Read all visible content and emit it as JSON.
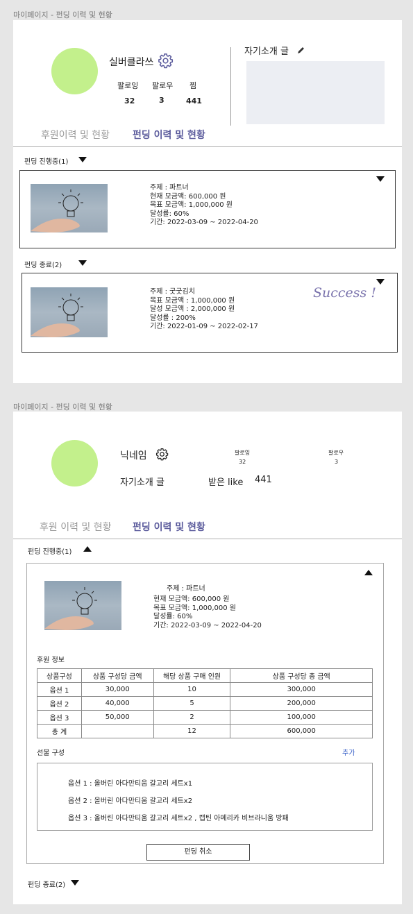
{
  "frame1": {
    "label": "마이페이지 - 펀딩 이력 및 현황",
    "profile": {
      "nickname": "실버클라쓰",
      "stats": [
        {
          "label": "팔로잉",
          "value": "32"
        },
        {
          "label": "팔로우",
          "value": "3"
        },
        {
          "label": "찜",
          "value": "441"
        }
      ]
    },
    "intro_title": "자기소개 글",
    "tabs": {
      "sponsor": "후원이력 및 현황",
      "funding": "펀딩 이력 및 현황"
    },
    "ongoing_header": "펀딩 진행중(1)",
    "ongoing_card": {
      "lines": [
        "주제 : 파트너",
        "현재 모금액: 600,000 원",
        "목표 모금액: 1,000,000 원",
        "달성률: 60%",
        "기간: 2022-03-09 ~ 2022-04-20"
      ]
    },
    "ended_header": "펀딩 종료(2)",
    "ended_card": {
      "lines": [
        "주제 : 굿굿김치",
        "목표 모금액 : 1,000,000 원",
        "달성 모금액 : 2,000,000 원",
        "달성률 : 200%",
        "기간: 2022-01-09 ~ 2022-02-17"
      ],
      "badge": "Success !"
    }
  },
  "frame2": {
    "label": "마이페이지 - 펀딩 이력 및 현황",
    "profile": {
      "nickname": "닉네임",
      "following_label": "팔로잉",
      "following_value": "32",
      "follower_label": "팔로우",
      "follower_value": "3",
      "intro": "자기소개 글",
      "likes_label": "받은 like",
      "likes_value": "441"
    },
    "tabs": {
      "sponsor": "후원 이력 및 현황",
      "funding": "펀딩 이력 및 현황"
    },
    "ongoing_header": "펀딩 진행중(1)",
    "card": {
      "lines": [
        "주제 : 파트너",
        "현재 모금액: 600,000 원",
        "목표 모금액: 1,000,000 원",
        "달성률: 60%",
        "기간: 2022-03-09 ~ 2022-04-20"
      ],
      "sponsor_title": "후원 정보",
      "table": {
        "headers": [
          "상품구성",
          "상품 구성당 금액",
          "해당 상품 구매 인원",
          "상품 구성당 총 금액"
        ],
        "rows": [
          [
            "옵션 1",
            "30,000",
            "10",
            "300,000"
          ],
          [
            "옵션 2",
            "40,000",
            "5",
            "200,000"
          ],
          [
            "옵션 3",
            "50,000",
            "2",
            "100,000"
          ],
          [
            "총 계",
            "",
            "12",
            "600,000"
          ]
        ]
      },
      "gift_title": "선물 구성",
      "add_label": "추가",
      "gifts": [
        "옵션 1 : 올버린 아다만티움 갈고리 세트x1",
        "옵션 2 : 올버린 아다만티움 갈고리 세트x2",
        "옵션 3 : 올버린 아다만티움 갈고리 세트x2 , 캡틴 아메리카 비브라니움 방패"
      ],
      "cancel_label": "펀딩 취소"
    },
    "ended_header": "펀딩 종료(2)"
  },
  "colors": {
    "avatar": "#c3f08c",
    "active_tab": "#5b5b9c",
    "success": "#7b74ad"
  }
}
